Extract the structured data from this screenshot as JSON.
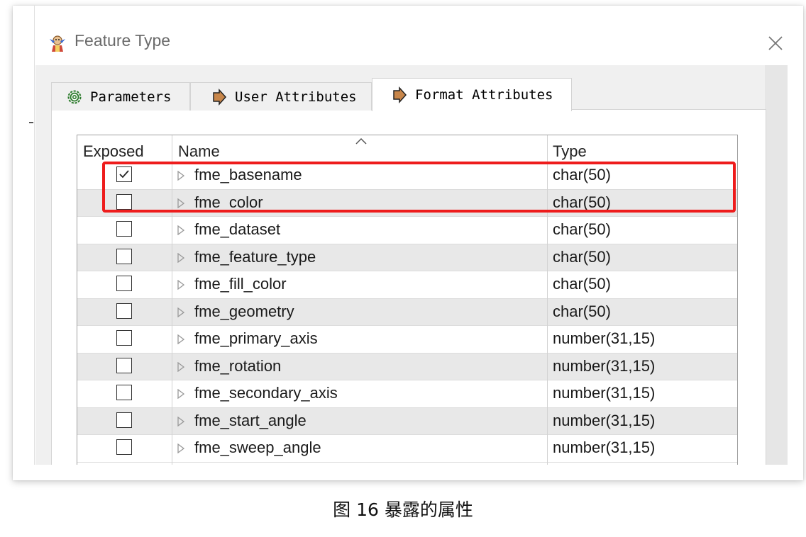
{
  "window": {
    "title": "Feature Type"
  },
  "tabs": [
    {
      "label": "Parameters",
      "icon": "gear-icon",
      "active": false
    },
    {
      "label": "User Attributes",
      "icon": "arrow-right-icon",
      "active": false
    },
    {
      "label": "Format Attributes",
      "icon": "arrow-right-icon",
      "active": true
    }
  ],
  "table": {
    "columns": [
      "Exposed",
      "Name",
      "Type"
    ],
    "rows": [
      {
        "exposed": true,
        "name": "fme_basename",
        "type": "char(50)"
      },
      {
        "exposed": false,
        "name": "fme_color",
        "type": "char(50)"
      },
      {
        "exposed": false,
        "name": "fme_dataset",
        "type": "char(50)"
      },
      {
        "exposed": false,
        "name": "fme_feature_type",
        "type": "char(50)"
      },
      {
        "exposed": false,
        "name": "fme_fill_color",
        "type": "char(50)"
      },
      {
        "exposed": false,
        "name": "fme_geometry",
        "type": "char(50)"
      },
      {
        "exposed": false,
        "name": "fme_primary_axis",
        "type": "number(31,15)"
      },
      {
        "exposed": false,
        "name": "fme_rotation",
        "type": "number(31,15)"
      },
      {
        "exposed": false,
        "name": "fme_secondary_axis",
        "type": "number(31,15)"
      },
      {
        "exposed": false,
        "name": "fme_start_angle",
        "type": "number(31,15)"
      },
      {
        "exposed": false,
        "name": "fme_sweep_angle",
        "type": "number(31,15)"
      }
    ]
  },
  "caption": "图 16 暴露的属性",
  "colors": {
    "highlight": "#ee1c1c",
    "alt_row": "#e8e8e8",
    "tab_icon": "#c8864a"
  }
}
